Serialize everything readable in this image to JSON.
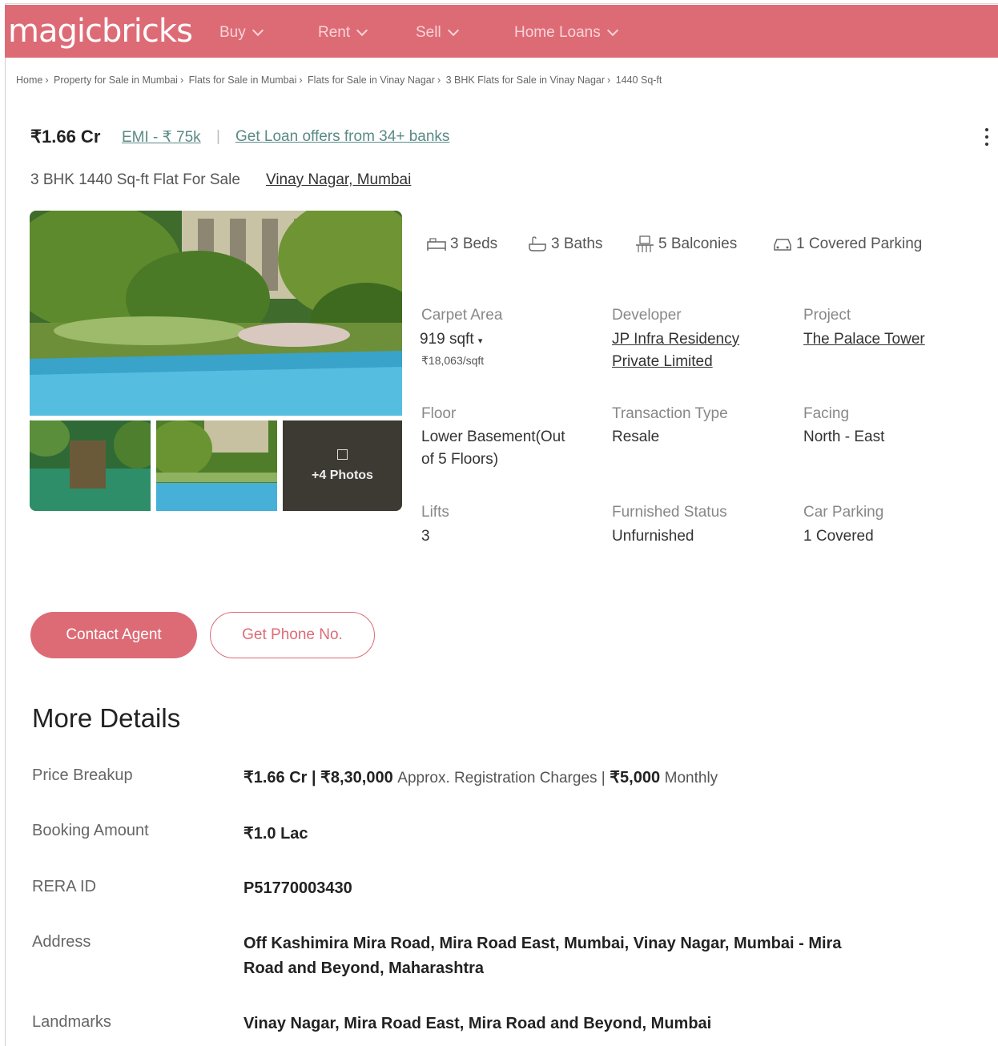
{
  "brand": {
    "logo": "magicbricks",
    "color": "#dd6b76"
  },
  "nav": [
    {
      "label": "Buy"
    },
    {
      "label": "Rent"
    },
    {
      "label": "Sell"
    },
    {
      "label": "Home Loans"
    }
  ],
  "breadcrumb": [
    "Home",
    "Property for Sale in Mumbai",
    "Flats for Sale in Mumbai",
    "Flats for Sale in Vinay Nagar",
    "3 BHK Flats for Sale in Vinay Nagar",
    "1440 Sq-ft"
  ],
  "listing": {
    "price": "₹1.66 Cr",
    "emi": "EMI - ₹ 75k",
    "separator": "|",
    "loan_offer": "Get Loan offers from 34+ banks",
    "subtitle": "3 BHK 1440 Sq-ft Flat For Sale",
    "location": "Vinay Nagar, Mumbai"
  },
  "gallery": {
    "more_photos": "+4 Photos"
  },
  "amenities": [
    {
      "icon": "bed-icon",
      "label": "3 Beds"
    },
    {
      "icon": "bath-icon",
      "label": "3 Baths"
    },
    {
      "icon": "balcony-icon",
      "label": "5 Balconies"
    },
    {
      "icon": "parking-icon",
      "label": "1 Covered Parking"
    }
  ],
  "specs": {
    "carpet_area": {
      "label": "Carpet Area",
      "value": "919 sqft",
      "sub": "₹18,063/sqft"
    },
    "developer": {
      "label": "Developer",
      "line1": "JP Infra Residency",
      "line2": "Private Limited"
    },
    "project": {
      "label": "Project",
      "value": "The Palace Tower"
    },
    "floor": {
      "label": "Floor",
      "line1": "Lower Basement(Out",
      "line2": "of 5 Floors)"
    },
    "transaction": {
      "label": "Transaction Type",
      "value": "Resale"
    },
    "facing": {
      "label": "Facing",
      "value": "North - East"
    },
    "lifts": {
      "label": "Lifts",
      "value": "3"
    },
    "furnished": {
      "label": "Furnished Status",
      "value": "Unfurnished"
    },
    "car_parking": {
      "label": "Car Parking",
      "value": "1 Covered"
    }
  },
  "actions": {
    "contact": "Contact Agent",
    "phone": "Get Phone No."
  },
  "more_details": {
    "title": "More Details",
    "price_breakup": {
      "label": "Price Breakup",
      "price": "₹1.66 Cr | ₹8,30,000",
      "reg": "Approx. Registration Charges |",
      "maintenance": "₹5,000",
      "period": "Monthly"
    },
    "booking": {
      "label": "Booking Amount",
      "value": "₹1.0 Lac"
    },
    "rera": {
      "label": "RERA ID",
      "value": "P51770003430"
    },
    "address": {
      "label": "Address",
      "line1": "Off Kashimira Mira Road, Mira Road East, Mumbai, Vinay Nagar, Mumbai - Mira",
      "line2": "Road and Beyond, Maharashtra"
    },
    "landmarks": {
      "label": "Landmarks",
      "value": "Vinay Nagar, Mira Road East, Mira Road and Beyond, Mumbai"
    }
  }
}
